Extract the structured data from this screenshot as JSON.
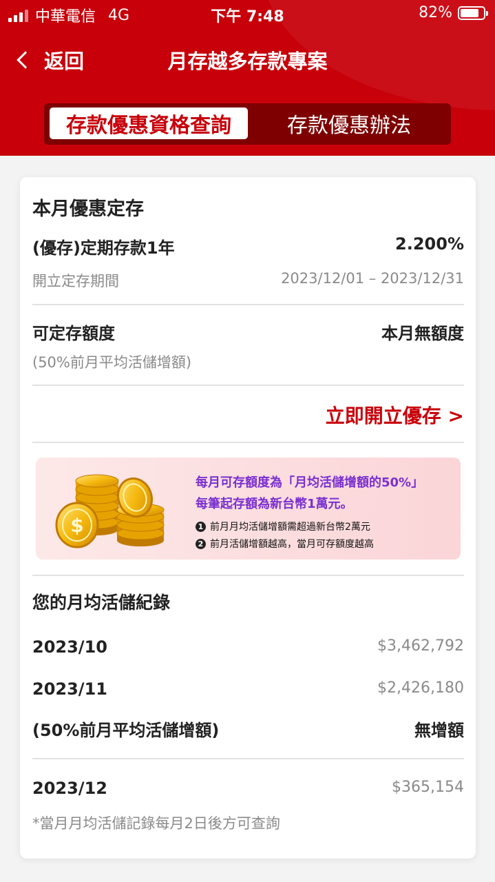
{
  "status_bar": {
    "carrier": "中華電信",
    "network": "4G",
    "time": "下午 7:48",
    "battery": "82%"
  },
  "nav": {
    "back_label": "返回",
    "title": "月存越多存款專案"
  },
  "tabs": [
    {
      "label": "存款優惠資格查詢",
      "active": true
    },
    {
      "label": "存款優惠辦法",
      "active": false
    }
  ],
  "offer": {
    "section_title": "本月優惠定存",
    "product_name": "(優存)定期存款1年",
    "rate": "2.200%",
    "period_label": "開立定存期間",
    "period_value": "2023/12/01 – 2023/12/31"
  },
  "quota": {
    "label": "可定存額度",
    "value": "本月無額度",
    "note": "(50%前月平均活儲增額)"
  },
  "cta": {
    "label": "立即開立優存 >"
  },
  "promo": {
    "line1": "每月可存額度為「月均活儲增額的50%」",
    "line2": "每筆起存額為新台幣1萬元。",
    "notes": [
      {
        "num": "1",
        "text": "前月月均活儲增額需超過新台幣2萬元"
      },
      {
        "num": "2",
        "text": "前月活儲增額越高，當月可存額度越高"
      }
    ]
  },
  "records": {
    "title": "您的月均活儲紀錄",
    "rows": [
      {
        "month": "2023/10",
        "amount": "$3,462,792"
      },
      {
        "month": "2023/11",
        "amount": "$2,426,180"
      }
    ],
    "increase_label": "(50%前月平均活儲增額)",
    "increase_value": "無增額",
    "current": {
      "month": "2023/12",
      "amount": "$365,154"
    },
    "footnote": "*當月月均活儲記錄每月2日後方可查詢"
  },
  "colors": {
    "brand_red": "#c8000a",
    "segment_bg": "#7e0000",
    "promo_purple": "#7a2fd1"
  }
}
